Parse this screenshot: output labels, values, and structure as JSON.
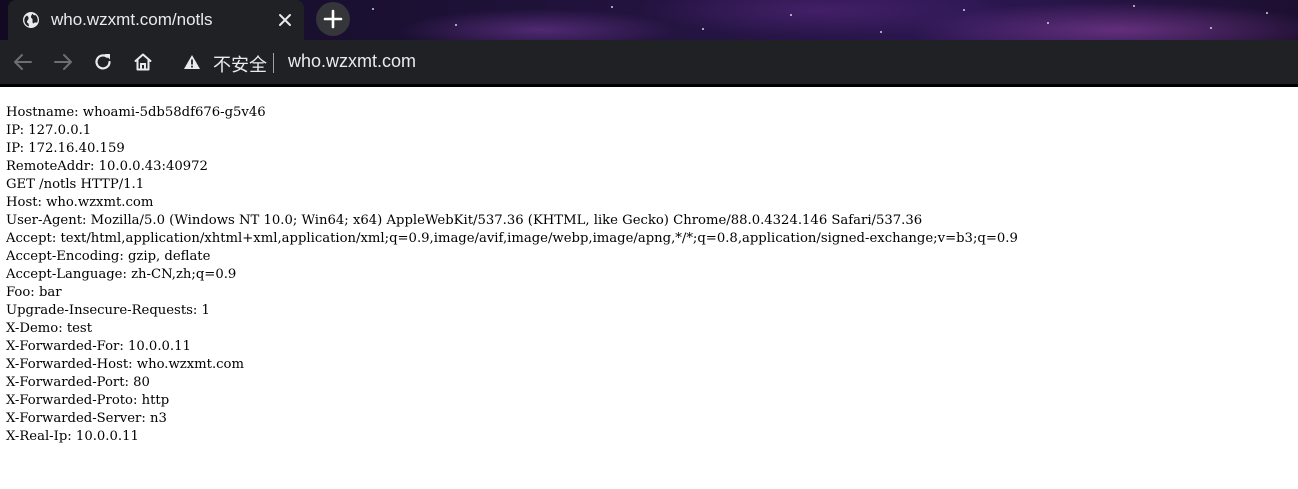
{
  "browser": {
    "tab": {
      "title": "who.wzxmt.com/notls",
      "favicon_icon": "globe-icon",
      "close_icon": "close-icon"
    },
    "new_tab_icon": "plus-icon",
    "toolbar": {
      "back_icon": "arrow-left-icon",
      "forward_icon": "arrow-right-icon",
      "reload_icon": "reload-icon",
      "home_icon": "home-icon"
    },
    "omnibox": {
      "security_icon": "warning-icon",
      "security_label": "不安全",
      "url": "who.wzxmt.com"
    },
    "colors": {
      "chrome_dark": "#202124",
      "text_light": "#e8eaed"
    }
  },
  "page": {
    "lines": [
      "Hostname: whoami-5db58df676-g5v46",
      "IP: 127.0.0.1",
      "IP: 172.16.40.159",
      "RemoteAddr: 10.0.0.43:40972",
      "GET /notls HTTP/1.1",
      "Host: who.wzxmt.com",
      "User-Agent: Mozilla/5.0 (Windows NT 10.0; Win64; x64) AppleWebKit/537.36 (KHTML, like Gecko) Chrome/88.0.4324.146 Safari/537.36",
      "Accept: text/html,application/xhtml+xml,application/xml;q=0.9,image/avif,image/webp,image/apng,*/*;q=0.8,application/signed-exchange;v=b3;q=0.9",
      "Accept-Encoding: gzip, deflate",
      "Accept-Language: zh-CN,zh;q=0.9",
      "Foo: bar",
      "Upgrade-Insecure-Requests: 1",
      "X-Demo: test",
      "X-Forwarded-For: 10.0.0.11",
      "X-Forwarded-Host: who.wzxmt.com",
      "X-Forwarded-Port: 80",
      "X-Forwarded-Proto: http",
      "X-Forwarded-Server: n3",
      "X-Real-Ip: 10.0.0.11"
    ]
  }
}
